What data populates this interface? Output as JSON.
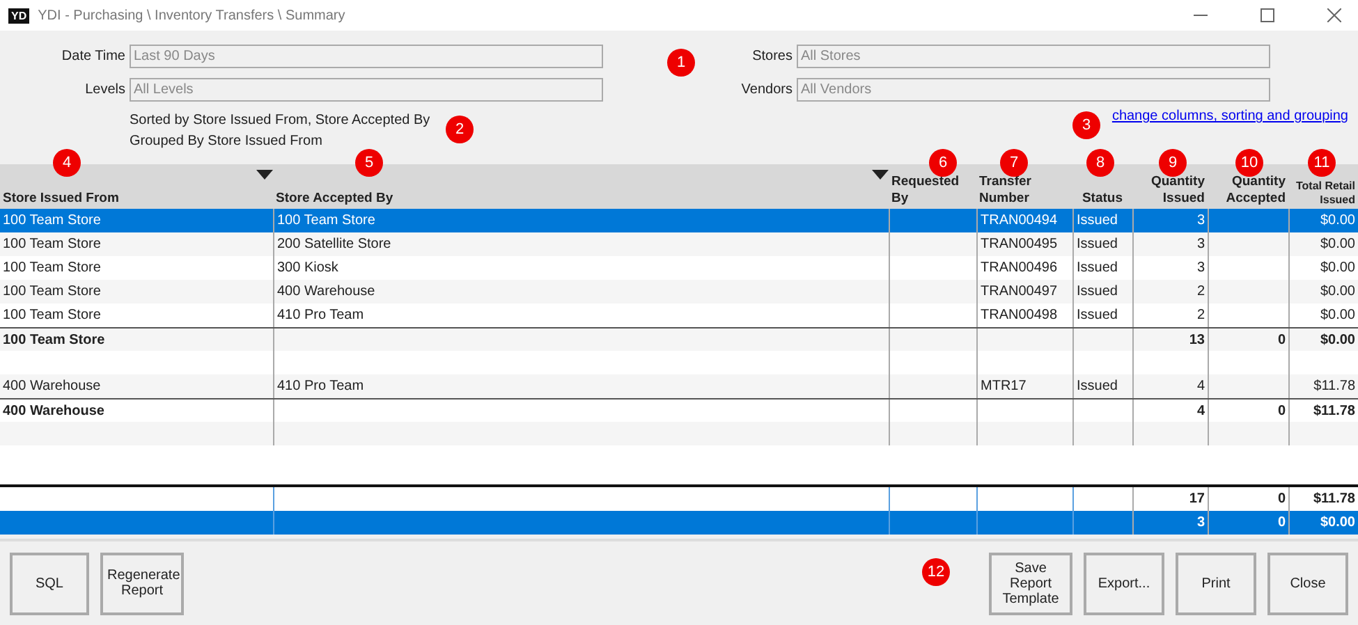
{
  "window": {
    "logo": "YD",
    "title": "YDI - Purchasing \\ Inventory Transfers \\ Summary"
  },
  "filters": [
    {
      "label": "Date Time",
      "value": "Last 90 Days"
    },
    {
      "label": "Stores",
      "value": "All Stores"
    },
    {
      "label": "Levels",
      "value": "All Levels"
    },
    {
      "label": "Vendors",
      "value": "All Vendors"
    }
  ],
  "sort_info": [
    "Sorted by Store Issued From, Store Accepted By",
    "Grouped By Store Issued From"
  ],
  "options_link": "change columns, sorting and grouping",
  "table": {
    "columns": [
      {
        "label": "Store Issued From",
        "sort_arrow": true
      },
      {
        "label": "Store Accepted By",
        "sort_arrow": true
      },
      {
        "label": "Requested By",
        "sort_arrow": false
      },
      {
        "label": "Transfer Number",
        "sort_arrow": false
      },
      {
        "label": "Status",
        "sort_arrow": false
      },
      {
        "label": "Quantity Issued",
        "sort_arrow": false
      },
      {
        "label": "Quantity Accepted",
        "sort_arrow": false
      },
      {
        "label": "Total Retail Issued",
        "sort_arrow": false
      }
    ],
    "rows": [
      {
        "kind": "detail",
        "selected": true,
        "issued_from": "100 Team Store",
        "accepted_by": "100 Team Store",
        "transfer_number": "TRAN00494",
        "status": "Issued",
        "qty_issued": "3",
        "total_retail": "$0.00"
      },
      {
        "kind": "detail",
        "selected": false,
        "issued_from": "100 Team Store",
        "accepted_by": "200 Satellite Store",
        "transfer_number": "TRAN00495",
        "status": "Issued",
        "qty_issued": "3",
        "total_retail": "$0.00"
      },
      {
        "kind": "detail",
        "selected": false,
        "issued_from": "100 Team Store",
        "accepted_by": "300 Kiosk",
        "transfer_number": "TRAN00496",
        "status": "Issued",
        "qty_issued": "3",
        "total_retail": "$0.00"
      },
      {
        "kind": "detail",
        "selected": false,
        "issued_from": "100 Team Store",
        "accepted_by": "400 Warehouse",
        "transfer_number": "TRAN00497",
        "status": "Issued",
        "qty_issued": "2",
        "total_retail": "$0.00"
      },
      {
        "kind": "detail",
        "selected": false,
        "issued_from": "100 Team Store",
        "accepted_by": "410 Pro Team",
        "transfer_number": "TRAN00498",
        "status": "Issued",
        "qty_issued": "2",
        "total_retail": "$0.00"
      },
      {
        "kind": "subtotal",
        "selected": false,
        "issued_from": "100 Team Store",
        "qty_issued": "13",
        "qty_accepted": "0",
        "total_retail": "$0.00"
      },
      {
        "kind": "blank",
        "selected": false
      },
      {
        "kind": "detail",
        "selected": false,
        "issued_from": "400 Warehouse",
        "accepted_by": "410 Pro Team",
        "transfer_number": "MTR17",
        "status": "Issued",
        "qty_issued": "4",
        "total_retail": "$11.78"
      },
      {
        "kind": "subtotal",
        "selected": false,
        "issued_from": "400 Warehouse",
        "qty_issued": "4",
        "qty_accepted": "0",
        "total_retail": "$11.78"
      },
      {
        "kind": "blank",
        "selected": false
      }
    ],
    "totals": [
      {
        "selected": false,
        "qty_issued": "17",
        "qty_accepted": "0",
        "total_retail": "$11.78"
      },
      {
        "selected": true,
        "qty_issued": "3",
        "qty_accepted": "0",
        "total_retail": "$0.00"
      }
    ]
  },
  "left_buttons": [
    "SQL",
    "Regenerate Report"
  ],
  "right_buttons": [
    "Save Report Template",
    "Export...",
    "Print",
    "Close"
  ],
  "markers": [
    "1",
    "2",
    "3",
    "4",
    "5",
    "6",
    "7",
    "8",
    "9",
    "10",
    "11",
    "12"
  ]
}
